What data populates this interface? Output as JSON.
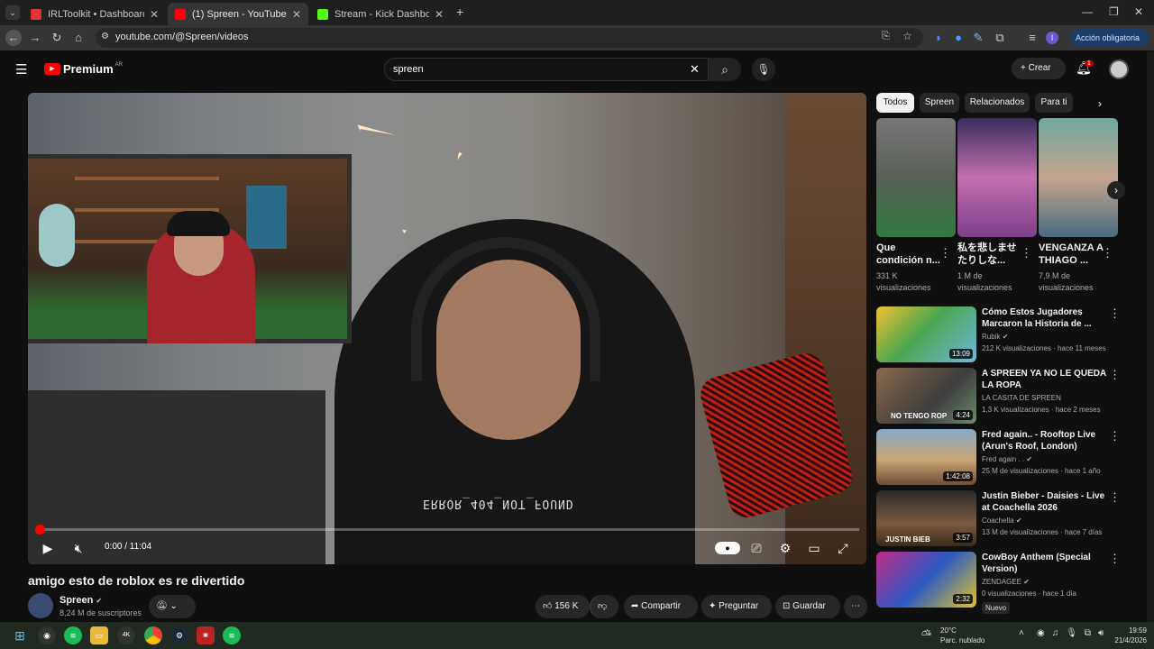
{
  "browser": {
    "tabs": [
      {
        "label": "IRLToolkit • Dashboard",
        "icon": "irltoolkit-icon",
        "color": "#d33"
      },
      {
        "label": "(1) Spreen - YouTube",
        "icon": "youtube-icon",
        "color": "#f00"
      },
      {
        "label": "Stream - Kick Dashboard",
        "icon": "kick-icon",
        "color": "#53fc18"
      }
    ],
    "url": "youtube.com/@Spreen/videos",
    "action_button": "Acción obligatoria"
  },
  "youtube": {
    "logo": "Premium",
    "region": "AR",
    "search_value": "spreen",
    "create_label": "Crear",
    "notification_count": "1"
  },
  "player": {
    "time": "0:00 / 11:04",
    "progress": 0.005,
    "shirt_text": "ERROR_404_NOT_FOUND"
  },
  "video": {
    "title": "amigo esto de roblox es re divertido",
    "channel": "Spreen",
    "subscribers": "8,24 M de suscriptores",
    "likes": "156 K",
    "share": "Compartir",
    "ask": "Preguntar",
    "save": "Guardar"
  },
  "chips": [
    "Todos",
    "Spreen",
    "Relacionados",
    "Para ti"
  ],
  "shorts": [
    {
      "title": "Que condición n...",
      "views": "331 K visualizaciones"
    },
    {
      "title": "私を悲しませたりしな...",
      "views": "1 M de visualizaciones"
    },
    {
      "title": "VENGANZA A THIAGO ...",
      "views": "7,9 M de visualizaciones"
    }
  ],
  "recommendations": [
    {
      "title": "Cómo Estos Jugadores Marcaron la Historia de ...",
      "channel": "Rubik",
      "meta": "212 K visualizaciones · hace 11 meses",
      "duration": "13:09",
      "verified": true
    },
    {
      "title": "A SPREEN YA NO LE QUEDA LA ROPA",
      "channel": "LA CASITA DE SPREEN",
      "meta": "1,3 K visualizaciones · hace 2 meses",
      "duration": "4:24",
      "overlay": "NO TENGO ROP",
      "verified": false
    },
    {
      "title": "Fred again.. - Rooftop Live (Arun's Roof, London)",
      "channel": "Fred again . .",
      "meta": "25 M de visualizaciones · hace 1 año",
      "duration": "1:42:08",
      "verified": true
    },
    {
      "title": "Justin Bieber - Daisies - Live at Coachella 2026",
      "channel": "Coachella",
      "meta": "13 M de visualizaciones · hace 7 días",
      "duration": "3:57",
      "overlay": "JUSTIN BIEB",
      "verified": true
    },
    {
      "title": "CowBoy Anthem (Special Version)",
      "channel": "ZENDAGEE",
      "meta": "0 visualizaciones · hace 1 día",
      "duration": "2:32",
      "badge": "Nuevo",
      "verified": true
    }
  ],
  "taskbar": {
    "temperature": "20°C",
    "weather": "Parc. nublado",
    "time": "19:59",
    "date": "21/4/2026"
  }
}
